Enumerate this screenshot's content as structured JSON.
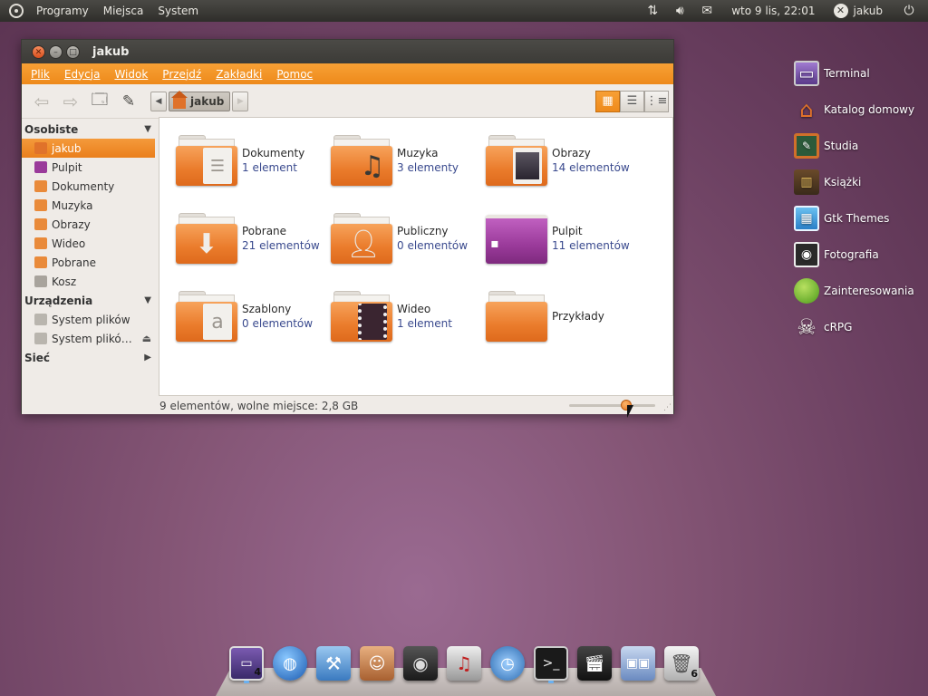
{
  "top_panel": {
    "menus": [
      "Programy",
      "Miejsca",
      "System"
    ],
    "clock": "wto  9 lis, 22:01",
    "user": "jakub",
    "user_icon": "x-icon",
    "icons": [
      "network-icon",
      "volume-icon",
      "mail-icon",
      "power-icon"
    ]
  },
  "window": {
    "title": "jakub",
    "menubar": [
      "Plik",
      "Edycja",
      "Widok",
      "Przejdź",
      "Zakładki",
      "Pomoc"
    ],
    "path_current": "jakub",
    "view_modes": [
      "icon-view",
      "list-view",
      "compact-view"
    ],
    "active_view": "icon-view",
    "accent_color": "#ee8a1b"
  },
  "sidebar": {
    "personal_header": "Osobiste",
    "personal_items": [
      {
        "label": "jakub",
        "icon": "home-icon",
        "selected": true
      },
      {
        "label": "Pulpit",
        "icon": "desktop-icon"
      },
      {
        "label": "Dokumenty",
        "icon": "documents-icon"
      },
      {
        "label": "Muzyka",
        "icon": "music-icon"
      },
      {
        "label": "Obrazy",
        "icon": "pictures-icon"
      },
      {
        "label": "Wideo",
        "icon": "video-icon"
      },
      {
        "label": "Pobrane",
        "icon": "downloads-icon"
      },
      {
        "label": "Kosz",
        "icon": "trash-icon"
      }
    ],
    "devices_header": "Urządzenia",
    "device_items": [
      {
        "label": "System plików",
        "icon": "drive-icon"
      },
      {
        "label": "System plikó…",
        "icon": "drive-icon",
        "eject": true
      }
    ],
    "network_header": "Sieć"
  },
  "files": [
    {
      "name": "Dokumenty",
      "count": "1 element",
      "emblem": "document-icon"
    },
    {
      "name": "Muzyka",
      "count": "3 elementy",
      "emblem": "music-note-icon"
    },
    {
      "name": "Obrazy",
      "count": "14 elementów",
      "emblem": "photo-icon"
    },
    {
      "name": "Pobrane",
      "count": "21 elementów",
      "emblem": "download-arrow-icon"
    },
    {
      "name": "Publiczny",
      "count": "0 elementów",
      "emblem": "person-icon"
    },
    {
      "name": "Pulpit",
      "count": "11 elementów",
      "emblem": "desktop-icon"
    },
    {
      "name": "Szablony",
      "count": "0 elementów",
      "emblem": "template-icon"
    },
    {
      "name": "Wideo",
      "count": "1 element",
      "emblem": "film-icon"
    },
    {
      "name": "Przykłady",
      "count": "",
      "emblem": ""
    }
  ],
  "statusbar": {
    "text": "9 elementów, wolne miejsce: 2,8 GB",
    "zoom_level": 0.66
  },
  "desktop_icons": [
    {
      "label": "Terminal",
      "icon": "monitor-icon"
    },
    {
      "label": "Katalog domowy",
      "icon": "house-icon"
    },
    {
      "label": "Studia",
      "icon": "chalkboard-icon"
    },
    {
      "label": "Książki",
      "icon": "bookshelf-icon"
    },
    {
      "label": "Gtk Themes",
      "icon": "themes-icon"
    },
    {
      "label": "Fotografia",
      "icon": "camera-icon"
    },
    {
      "label": "Zainteresowania",
      "icon": "apple-icon"
    },
    {
      "label": "cRPG",
      "icon": "skull-icon"
    }
  ],
  "dock": [
    {
      "icon": "window-switcher-icon",
      "badge": "4"
    },
    {
      "icon": "globe-browser-icon",
      "badge": ""
    },
    {
      "icon": "development-tools-icon",
      "badge": ""
    },
    {
      "icon": "photo-editor-icon",
      "badge": ""
    },
    {
      "icon": "camera-icon",
      "badge": ""
    },
    {
      "icon": "headphones-icon",
      "badge": ""
    },
    {
      "icon": "dashboard-icon",
      "badge": ""
    },
    {
      "icon": "terminal-icon",
      "badge": ""
    },
    {
      "icon": "clapperboard-icon",
      "badge": ""
    },
    {
      "icon": "network-manager-icon",
      "badge": ""
    },
    {
      "icon": "trash-icon",
      "badge": "6"
    }
  ]
}
